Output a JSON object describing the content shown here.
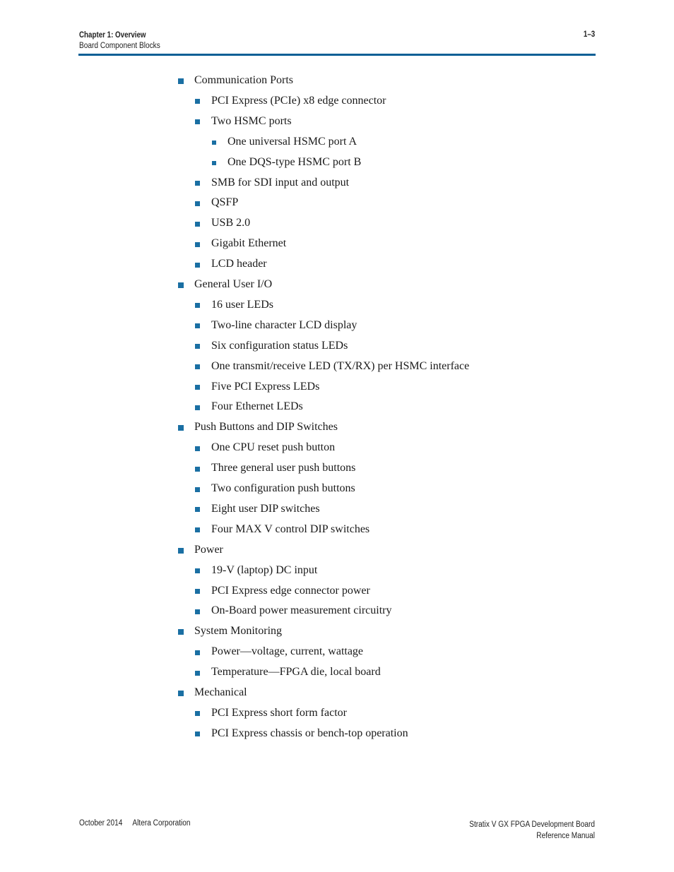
{
  "header": {
    "chapter": "Chapter 1:  Overview",
    "section": "Board Component Blocks",
    "page_number": "1–3",
    "rule_color": "#0b5f95"
  },
  "bullet_color": "#1a6fa3",
  "list": [
    {
      "level": 1,
      "text": "Communication Ports"
    },
    {
      "level": 2,
      "text": "PCI Express (PCIe) x8 edge connector"
    },
    {
      "level": 2,
      "text": "Two HSMC ports"
    },
    {
      "level": 3,
      "text": "One universal HSMC port A"
    },
    {
      "level": 3,
      "text": "One DQS-type HSMC port B"
    },
    {
      "level": 2,
      "text": "SMB for SDI input and output"
    },
    {
      "level": 2,
      "text": "QSFP"
    },
    {
      "level": 2,
      "text": "USB 2.0"
    },
    {
      "level": 2,
      "text": "Gigabit Ethernet"
    },
    {
      "level": 2,
      "text": "LCD header"
    },
    {
      "level": 1,
      "text": "General User I/O"
    },
    {
      "level": 2,
      "text": "16 user LEDs"
    },
    {
      "level": 2,
      "text": "Two-line character LCD display"
    },
    {
      "level": 2,
      "text": "Six configuration status LEDs"
    },
    {
      "level": 2,
      "text": "One transmit/receive LED (TX/RX) per HSMC interface"
    },
    {
      "level": 2,
      "text": "Five PCI Express LEDs"
    },
    {
      "level": 2,
      "text": "Four Ethernet LEDs"
    },
    {
      "level": 1,
      "text": "Push Buttons and DIP Switches"
    },
    {
      "level": 2,
      "text": "One CPU reset push button"
    },
    {
      "level": 2,
      "text": "Three general user push buttons"
    },
    {
      "level": 2,
      "text": "Two configuration push buttons"
    },
    {
      "level": 2,
      "text": "Eight user DIP switches"
    },
    {
      "level": 2,
      "text": "Four MAX V control DIP switches"
    },
    {
      "level": 1,
      "text": "Power"
    },
    {
      "level": 2,
      "text": "19-V (laptop) DC input"
    },
    {
      "level": 2,
      "text": "PCI Express edge connector power"
    },
    {
      "level": 2,
      "text": "On-Board power measurement circuitry"
    },
    {
      "level": 1,
      "text": "System Monitoring"
    },
    {
      "level": 2,
      "text": "Power—voltage, current, wattage"
    },
    {
      "level": 2,
      "text": "Temperature—FPGA die, local board"
    },
    {
      "level": 1,
      "text": "Mechanical"
    },
    {
      "level": 2,
      "text": "PCI Express short form factor"
    },
    {
      "level": 2,
      "text": "PCI Express chassis or bench-top operation"
    }
  ],
  "footer": {
    "date": "October 2014",
    "company": "Altera Corporation",
    "doc_title": "Stratix V GX FPGA Development Board",
    "doc_subtitle": "Reference Manual"
  }
}
